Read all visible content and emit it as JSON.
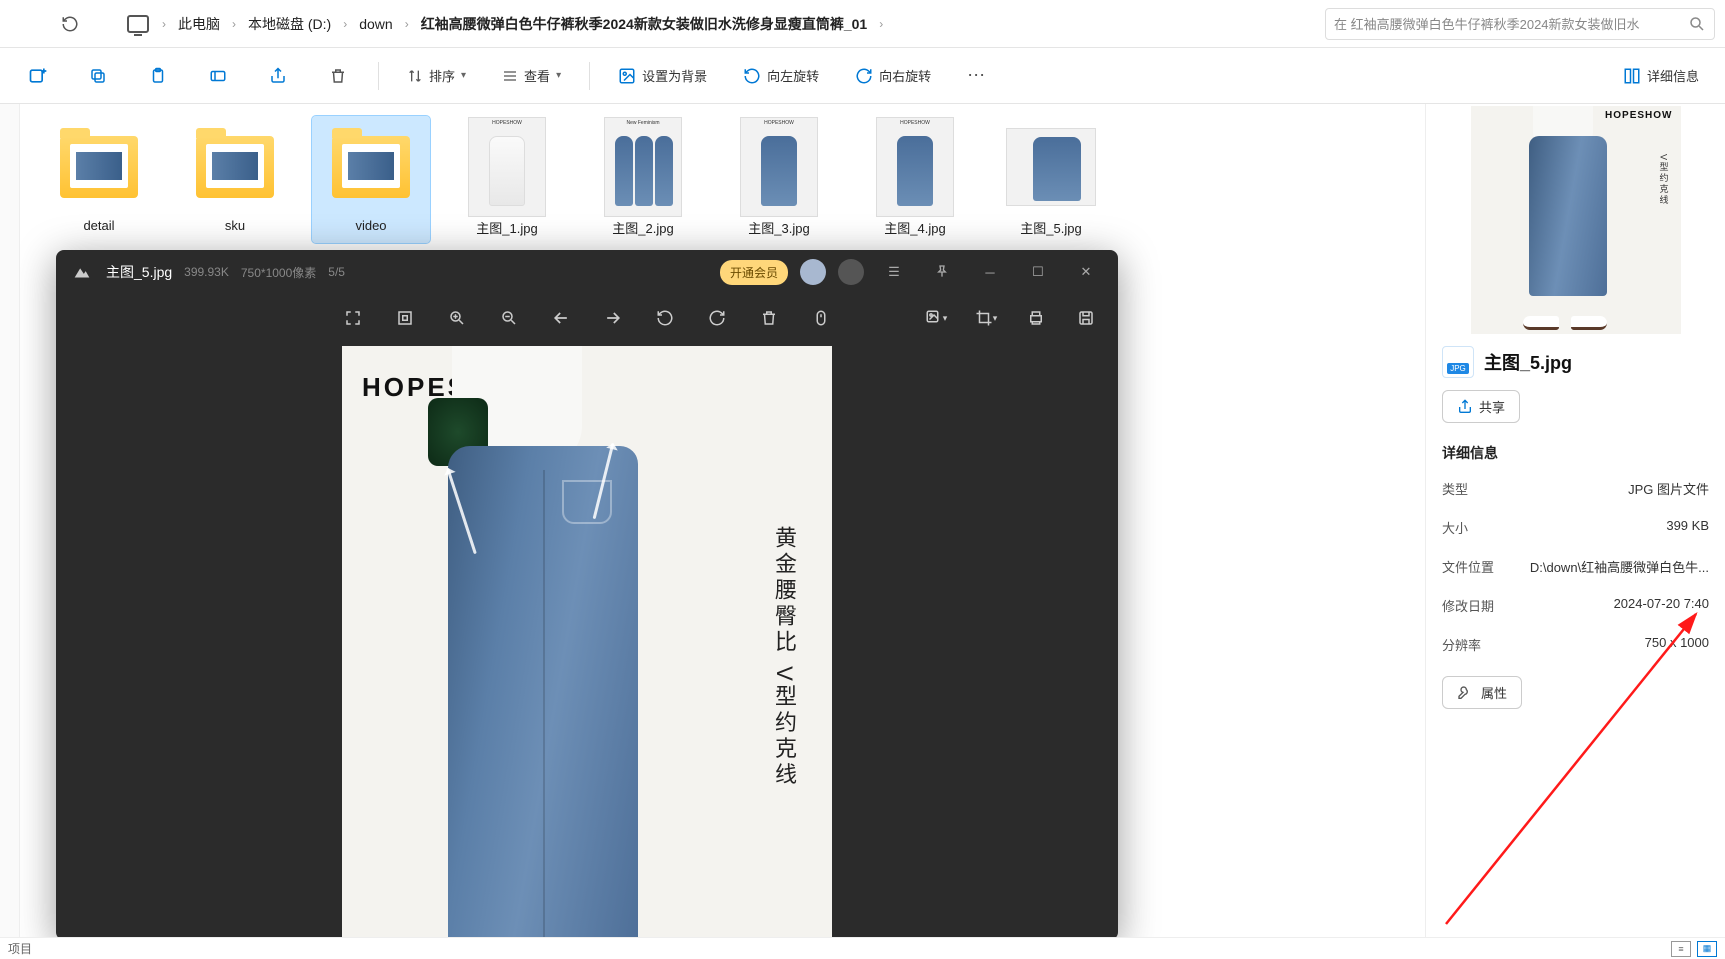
{
  "breadcrumbs": [
    "此电脑",
    "本地磁盘 (D:)",
    "down",
    "红袖高腰微弹白色牛仔裤秋季2024新款女装做旧水洗修身显瘦直筒裤_01"
  ],
  "search": {
    "placeholder": "在 红袖高腰微弹白色牛仔裤秋季2024新款女装做旧水"
  },
  "toolbar": {
    "sort": "排序",
    "view": "查看",
    "set_bg": "设置为背景",
    "rotate_left": "向左旋转",
    "rotate_right": "向右旋转",
    "details": "详细信息"
  },
  "files": [
    {
      "name": "detail",
      "type": "folder"
    },
    {
      "name": "sku",
      "type": "folder"
    },
    {
      "name": "video",
      "type": "folder",
      "selected": true
    },
    {
      "name": "主图_1.jpg",
      "type": "image"
    },
    {
      "name": "主图_2.jpg",
      "type": "image"
    },
    {
      "name": "主图_3.jpg",
      "type": "image"
    },
    {
      "name": "主图_4.jpg",
      "type": "image"
    },
    {
      "name": "主图_5.jpg",
      "type": "image"
    }
  ],
  "viewer": {
    "filename": "主图_5.jpg",
    "size": "399.93K",
    "dimensions": "750*1000像素",
    "index": "5/5",
    "premium": "开通会员",
    "image": {
      "brand": "HOPESHOW",
      "caption_col1": "黄金腰臀比",
      "caption_col2": "V型约克线"
    }
  },
  "details": {
    "preview_brand": "HOPESHOW",
    "preview_caption": "V型约克线",
    "filename": "主图_5.jpg",
    "share": "共享",
    "section": "详细信息",
    "rows": {
      "type_label": "类型",
      "type_value": "JPG 图片文件",
      "size_label": "大小",
      "size_value": "399 KB",
      "path_label": "文件位置",
      "path_value": "D:\\down\\红袖高腰微弹白色牛...",
      "date_label": "修改日期",
      "date_value": "2024-07-20 7:40",
      "res_label": "分辨率",
      "res_value": "750 x 1000"
    },
    "properties": "属性"
  },
  "status": {
    "left": "项目"
  }
}
